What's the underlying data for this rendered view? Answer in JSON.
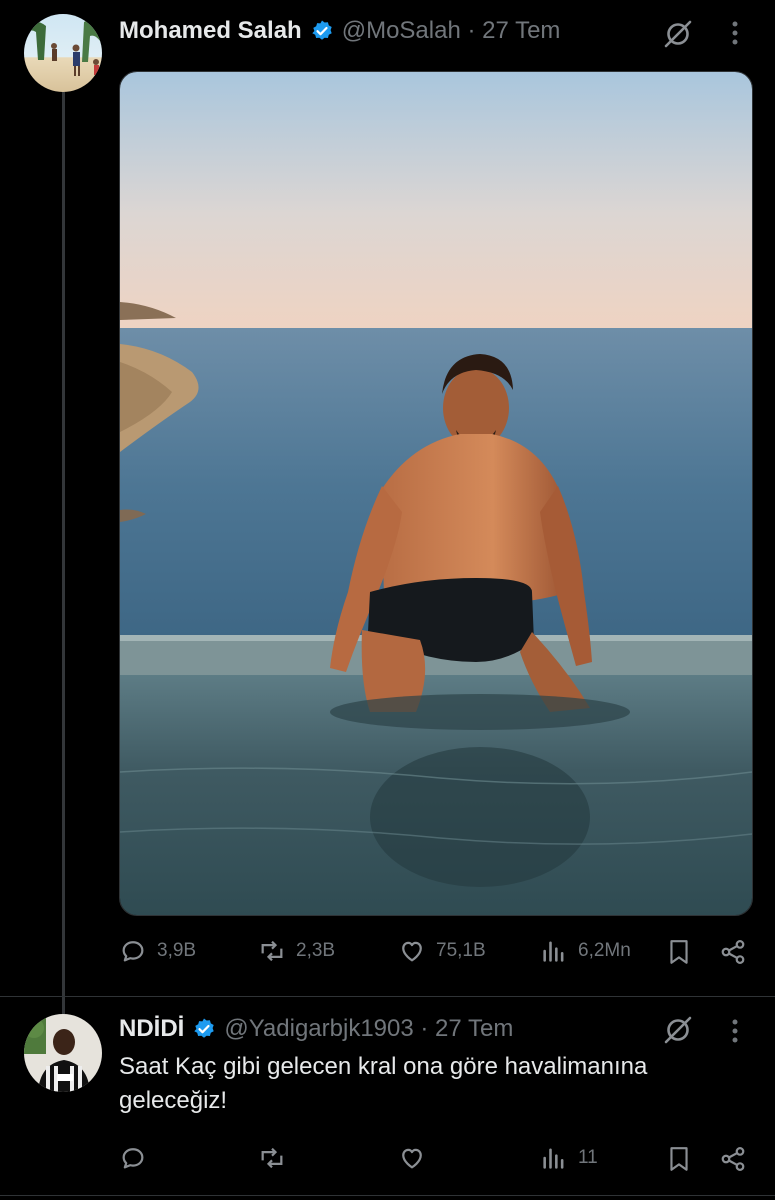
{
  "tweet1": {
    "name": "Mohamed Salah",
    "handle_time": "@MoSalah · 27 Tem",
    "replies": "3,9B",
    "retweets": "2,3B",
    "likes": "75,1B",
    "views": "6,2Mn"
  },
  "tweet2": {
    "name": "NDİDİ",
    "handle_time": "@Yadigarbjk1903 · 27 Tem",
    "text": "Saat Kaç gibi gelecen kral ona göre havalimanına geleceğiz!",
    "views": "11"
  },
  "colors": {
    "background": "#000000",
    "text": "#e7e9ea",
    "muted": "#71767b",
    "verified": "#1d9bf0"
  },
  "icons": [
    "grok-icon",
    "more-icon",
    "reply-icon",
    "retweet-icon",
    "like-icon",
    "views-icon",
    "bookmark-icon",
    "share-icon",
    "verified-badge-icon"
  ]
}
